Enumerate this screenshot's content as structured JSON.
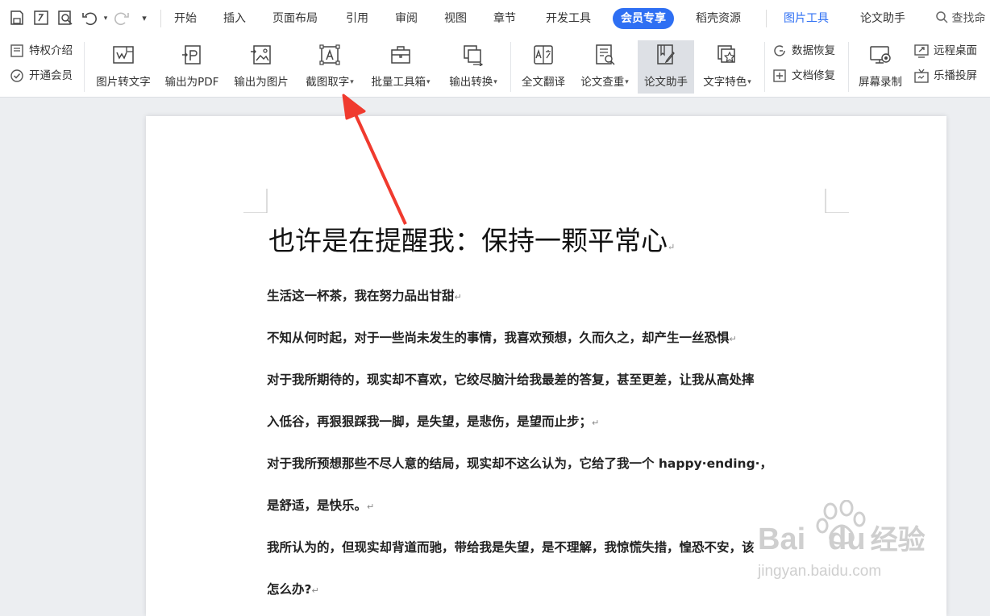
{
  "quick_access": [
    "save-icon",
    "export-icon",
    "preview-icon",
    "undo-icon",
    "redo-icon",
    "customize-icon"
  ],
  "tabs": [
    {
      "label": "开始"
    },
    {
      "label": "插入"
    },
    {
      "label": "页面布局"
    },
    {
      "label": "引用"
    },
    {
      "label": "审阅"
    },
    {
      "label": "视图"
    },
    {
      "label": "章节"
    },
    {
      "label": "开发工具"
    },
    {
      "label": "会员专享"
    },
    {
      "label": "稻壳资源"
    },
    {
      "label": "图片工具"
    },
    {
      "label": "论文助手"
    }
  ],
  "search": {
    "label": "查找命"
  },
  "ribbon": {
    "small_left": [
      {
        "label": "特权介绍"
      },
      {
        "label": "开通会员"
      }
    ],
    "big": [
      {
        "label": "图片转文字"
      },
      {
        "label": "输出为PDF"
      },
      {
        "label": "输出为图片"
      },
      {
        "label": "截图取字"
      },
      {
        "label": "批量工具箱"
      },
      {
        "label": "输出转换"
      },
      {
        "label": "全文翻译"
      },
      {
        "label": "论文查重"
      },
      {
        "label": "论文助手"
      },
      {
        "label": "文字特色"
      }
    ],
    "small_right": [
      {
        "label": "数据恢复"
      },
      {
        "label": "文档修复"
      },
      {
        "label": "屏幕录制"
      },
      {
        "label": "远程桌面"
      },
      {
        "label": "乐播投屏"
      }
    ]
  },
  "document": {
    "title": "也许是在提醒我：保持一颗平常心",
    "paragraphs": [
      "生活这一杯茶，我在努力品出甘甜",
      "不知从何时起，对于一些尚未发生的事情，我喜欢预想，久而久之，却产生一丝恐惧",
      "对于我所期待的，现实却不喜欢，它绞尽脑汁给我最差的答复，甚至更差，让我从高处摔",
      "入低谷，再狠狠踩我一脚，是失望，是悲伤，是望而止步；",
      "对于我所预想那些不尽人意的结局，现实却不这么认为，它给了我一个 happy·ending·，",
      "是舒适，是快乐。",
      "我所认为的，但现实却背道而驰，带给我是失望，是不理解，我惊慌失措，惶恐不安，该",
      "怎么办?"
    ]
  },
  "watermark": {
    "brand": "Bai",
    "brand2": "du",
    "cn": "经验",
    "url": "jingyan.baidu.com"
  },
  "colors": {
    "accent": "#2e6ff3",
    "annotation_arrow": "#f03a2e"
  }
}
